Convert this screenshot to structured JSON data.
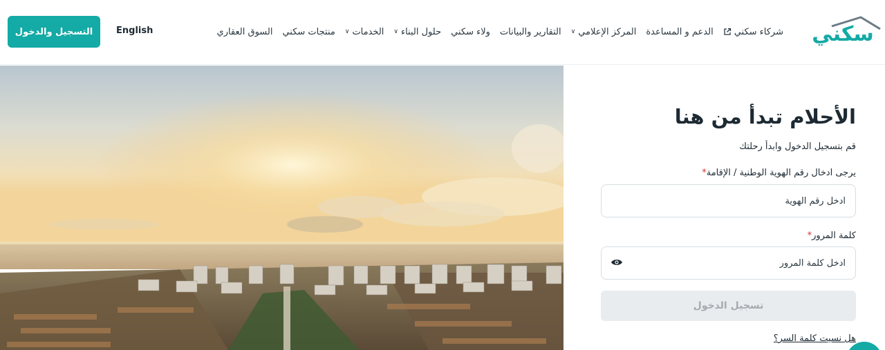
{
  "header": {
    "cta_label": "التسجيل والدخول",
    "lang_label": "English",
    "logo_text": "سكني",
    "nav": [
      {
        "label": "السوق العقاري",
        "chevron": false,
        "external": false
      },
      {
        "label": "منتجات سكني",
        "chevron": false,
        "external": false
      },
      {
        "label": "الخدمات",
        "chevron": true,
        "external": false
      },
      {
        "label": "حلول البناء",
        "chevron": true,
        "external": false
      },
      {
        "label": "ولاء سكني",
        "chevron": false,
        "external": false
      },
      {
        "label": "التقارير والبيانات",
        "chevron": false,
        "external": false
      },
      {
        "label": "المركز الإعلامي",
        "chevron": true,
        "external": false
      },
      {
        "label": "الدعم و المساعدة",
        "chevron": false,
        "external": false
      },
      {
        "label": "شركاء سكني",
        "chevron": false,
        "external": true
      }
    ]
  },
  "login": {
    "title": "الأحلام تبدأ من هنا",
    "subtitle": "قم بتسجيل الدخول وابدأ رحلتك",
    "id_label": "يرجى ادخال رقم الهوية الوطنية / الإقامة",
    "id_placeholder": "ادخل رقم الهوية",
    "password_label": "كلمة المرور",
    "password_placeholder": "ادخل كلمة المرور",
    "required_mark": "*",
    "submit_label": "تسجيل الدخول",
    "forgot_label": "هل نسيت كلمة السر؟"
  },
  "colors": {
    "brand": "#14aaa5",
    "required": "#d9342b",
    "disabled_button": "#e9ecef"
  },
  "icons": {
    "external_link": "external-link-icon",
    "chevron": "chevron-down-icon",
    "eye": "eye-icon",
    "logo": "house-roof-logo"
  }
}
